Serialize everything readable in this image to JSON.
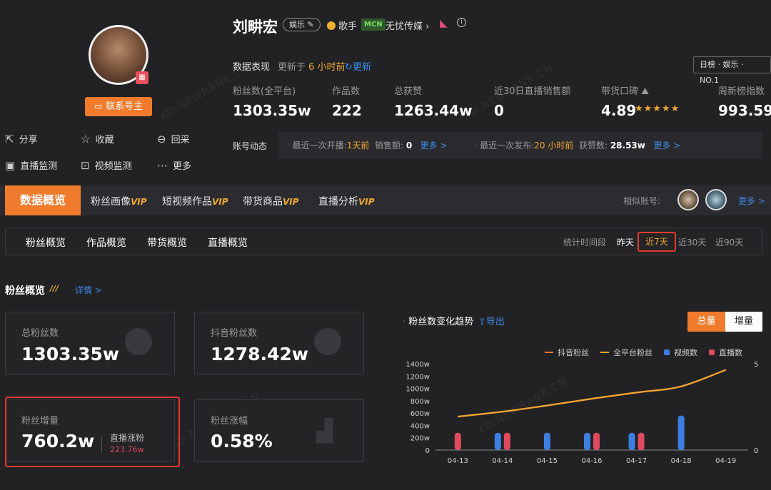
{
  "profile": {
    "name": "刘畊宏",
    "category_tag": "娱乐",
    "role": "歌手",
    "mcn_badge": "MCN",
    "mcn_name": "无忧传媒",
    "contact_button": "联系号主",
    "qr_icon": "qr-code-icon"
  },
  "actions": [
    {
      "label": "分享",
      "icon": "share-icon",
      "glyph": "⇱"
    },
    {
      "label": "收藏",
      "icon": "star-icon",
      "glyph": "☆"
    },
    {
      "label": "回采",
      "icon": "refresh-icon",
      "glyph": "⊖"
    },
    {
      "label": "直播监测",
      "icon": "live-icon",
      "glyph": "▣"
    },
    {
      "label": "视频监测",
      "icon": "chart-icon",
      "glyph": "⊡"
    },
    {
      "label": "更多",
      "icon": "more-icon",
      "glyph": "⋯"
    }
  ],
  "data_perf": {
    "label": "数据表现",
    "updated_prefix": "更新于",
    "updated_time": "6 小时前",
    "update_link": "更新",
    "rank_badge": "日榜 · 娱乐 · NO.1"
  },
  "stats": [
    {
      "label": "粉丝数(全平台)",
      "value": "1303.35w"
    },
    {
      "label": "作品数",
      "value": "222"
    },
    {
      "label": "总获赞",
      "value": "1263.44w"
    },
    {
      "label": "近30日直播销售额",
      "value": "0"
    },
    {
      "label": "带货口碑",
      "value": "4.89",
      "stars": 5
    },
    {
      "label": "周新榜指数",
      "value": "993.59"
    }
  ],
  "dynamics": {
    "label": "账号动态",
    "live_prefix": "最近一次开播:",
    "live_time": "1天前",
    "sales_label": "销售额:",
    "sales_value": "0",
    "more1": "更多 >",
    "publish_prefix": "最近一次发布:",
    "publish_time": "20 小时前",
    "likes_label": "获赞数:",
    "likes_value": "28.53w",
    "more2": "更多 >"
  },
  "main_tabs": [
    {
      "label": "数据概览",
      "vip": ""
    },
    {
      "label": "粉丝画像",
      "vip": "VIP"
    },
    {
      "label": "短视频作品",
      "vip": "VIP"
    },
    {
      "label": "带货商品",
      "vip": "VIP"
    },
    {
      "label": "直播分析",
      "vip": "VIP"
    }
  ],
  "similar": {
    "label": "相似账号:",
    "more": "更多 >"
  },
  "sub_tabs": [
    "粉丝概览",
    "作品概览",
    "带货概览",
    "直播概览"
  ],
  "time_range": {
    "label": "统计时间段",
    "options": [
      "昨天",
      "近7天",
      "近30天",
      "近90天"
    ],
    "selected": "近7天"
  },
  "section": {
    "title": "粉丝概览",
    "detail": "详情 >"
  },
  "cards": {
    "total_fans": {
      "label": "总粉丝数",
      "value": "1303.35w"
    },
    "douyin_fans": {
      "label": "抖音粉丝数",
      "value": "1278.42w"
    },
    "fan_increase": {
      "label": "粉丝增量",
      "value": "760.2w",
      "live_label": "直播涨粉",
      "live_value": "223.76w"
    },
    "fan_growth": {
      "label": "粉丝涨幅",
      "value": "0.58%"
    }
  },
  "chart_header": {
    "title": "粉丝数变化趋势",
    "export": "导出",
    "btn_total": "总量",
    "btn_inc": "增量"
  },
  "colors": {
    "accent": "#f07b2c",
    "douyin_line": "#f07b2c",
    "all_line": "#f0a830",
    "video_bar": "#3d7fe0",
    "live_bar": "#e04a5e",
    "highlight": "#e23a2c"
  },
  "chart_data": {
    "type": "line",
    "categories": [
      "04-13",
      "04-14",
      "04-15",
      "04-16",
      "04-17",
      "04-18",
      "04-19"
    ],
    "legend": [
      "抖音粉丝",
      "全平台粉丝",
      "视频数",
      "直播数"
    ],
    "y_left_ticks": [
      "0",
      "200w",
      "400w",
      "600w",
      "800w",
      "1000w",
      "1200w",
      "1400w"
    ],
    "y_right_ticks": [
      "0",
      "5"
    ],
    "ylim_left": [
      0,
      1400
    ],
    "ylim_right": [
      0,
      5
    ],
    "series": [
      {
        "name": "抖音粉丝",
        "type": "line",
        "axis": "left",
        "values": [
          540,
          620,
          720,
          830,
          930,
          1030,
          1300
        ]
      },
      {
        "name": "全平台粉丝",
        "type": "line",
        "axis": "left",
        "values": [
          545,
          625,
          725,
          835,
          935,
          1035,
          1303
        ]
      },
      {
        "name": "视频数",
        "type": "bar",
        "axis": "right",
        "values": [
          0,
          1,
          1,
          1,
          1,
          2,
          0
        ]
      },
      {
        "name": "直播数",
        "type": "bar",
        "axis": "right",
        "values": [
          1,
          1,
          0,
          1,
          1,
          0,
          0
        ]
      }
    ]
  }
}
